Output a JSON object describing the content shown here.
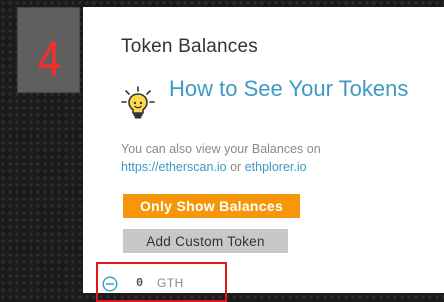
{
  "step": {
    "number": "4",
    "color": "#ff2a2a"
  },
  "section": {
    "title": "Token Balances"
  },
  "help": {
    "icon": "lightbulb-icon",
    "title": "How to See Your Tokens",
    "text_before": "You can also view your Balances on",
    "link_etherscan": "https://etherscan.io",
    "text_or": "or",
    "link_ethplorer": "ethplorer.io"
  },
  "buttons": {
    "show_balances": "Only Show Balances",
    "add_custom": "Add Custom Token"
  },
  "tokens": [
    {
      "amount": "0",
      "symbol": "GTH",
      "remove_icon": "minus-circle-icon"
    }
  ],
  "colors": {
    "accent_link": "#3d9ac4",
    "primary_button": "#f6960a",
    "secondary_button": "#c8c8c8",
    "highlight": "#e01818"
  }
}
